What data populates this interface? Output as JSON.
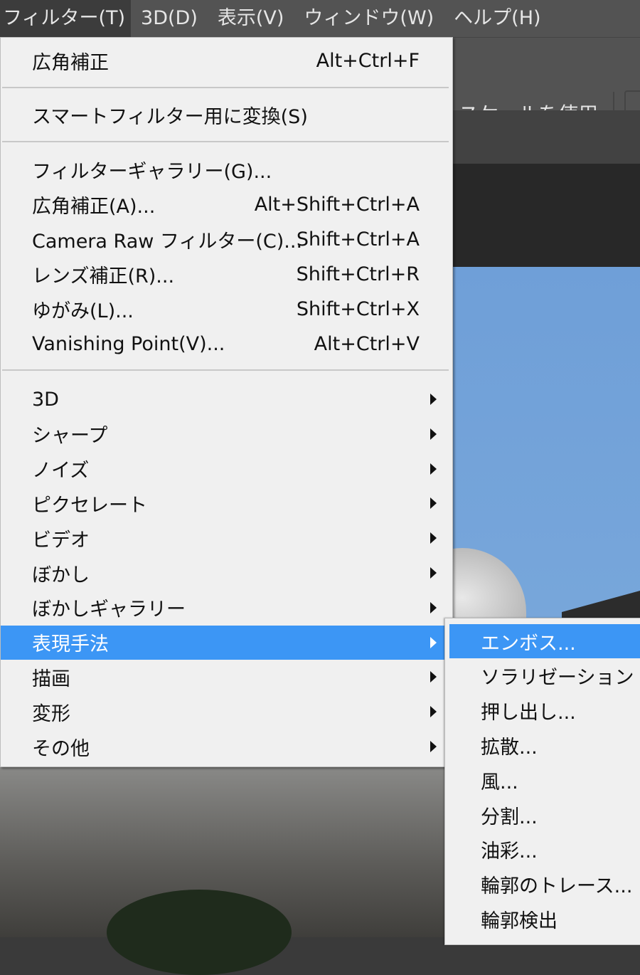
{
  "menubar": {
    "items": [
      "フィルター(T)",
      "3D(D)",
      "表示(V)",
      "ウィンドウ(W)",
      "ヘルプ(H)"
    ]
  },
  "options_bar": {
    "label": "スケールを使用"
  },
  "filter_menu": {
    "last_filter": {
      "label": "広角補正",
      "shortcut": "Alt+Ctrl+F"
    },
    "convert": {
      "label": "スマートフィルター用に変換(S)"
    },
    "group1": [
      {
        "label": "フィルターギャラリー(G)...",
        "shortcut": ""
      },
      {
        "label": "広角補正(A)...",
        "shortcut": "Alt+Shift+Ctrl+A"
      },
      {
        "label": "Camera Raw フィルター(C)...",
        "shortcut": "Shift+Ctrl+A"
      },
      {
        "label": "レンズ補正(R)...",
        "shortcut": "Shift+Ctrl+R"
      },
      {
        "label": "ゆがみ(L)...",
        "shortcut": "Shift+Ctrl+X"
      },
      {
        "label": "Vanishing Point(V)...",
        "shortcut": "Alt+Ctrl+V"
      }
    ],
    "submenus": [
      "3D",
      "シャープ",
      "ノイズ",
      "ピクセレート",
      "ビデオ",
      "ぼかし",
      "ぼかしギャラリー",
      "表現手法",
      "描画",
      "変形",
      "その他"
    ],
    "highlighted": "表現手法"
  },
  "stylize_submenu": {
    "items": [
      "エンボス...",
      "ソラリゼーション",
      "押し出し...",
      "拡散...",
      "風...",
      "分割...",
      "油彩...",
      "輪郭のトレース...",
      "輪郭検出"
    ],
    "highlighted": "エンボス..."
  },
  "colors": {
    "highlight": "#3c96f5",
    "menu_bg": "#f0f0f0",
    "menubar_bg": "#535353"
  }
}
